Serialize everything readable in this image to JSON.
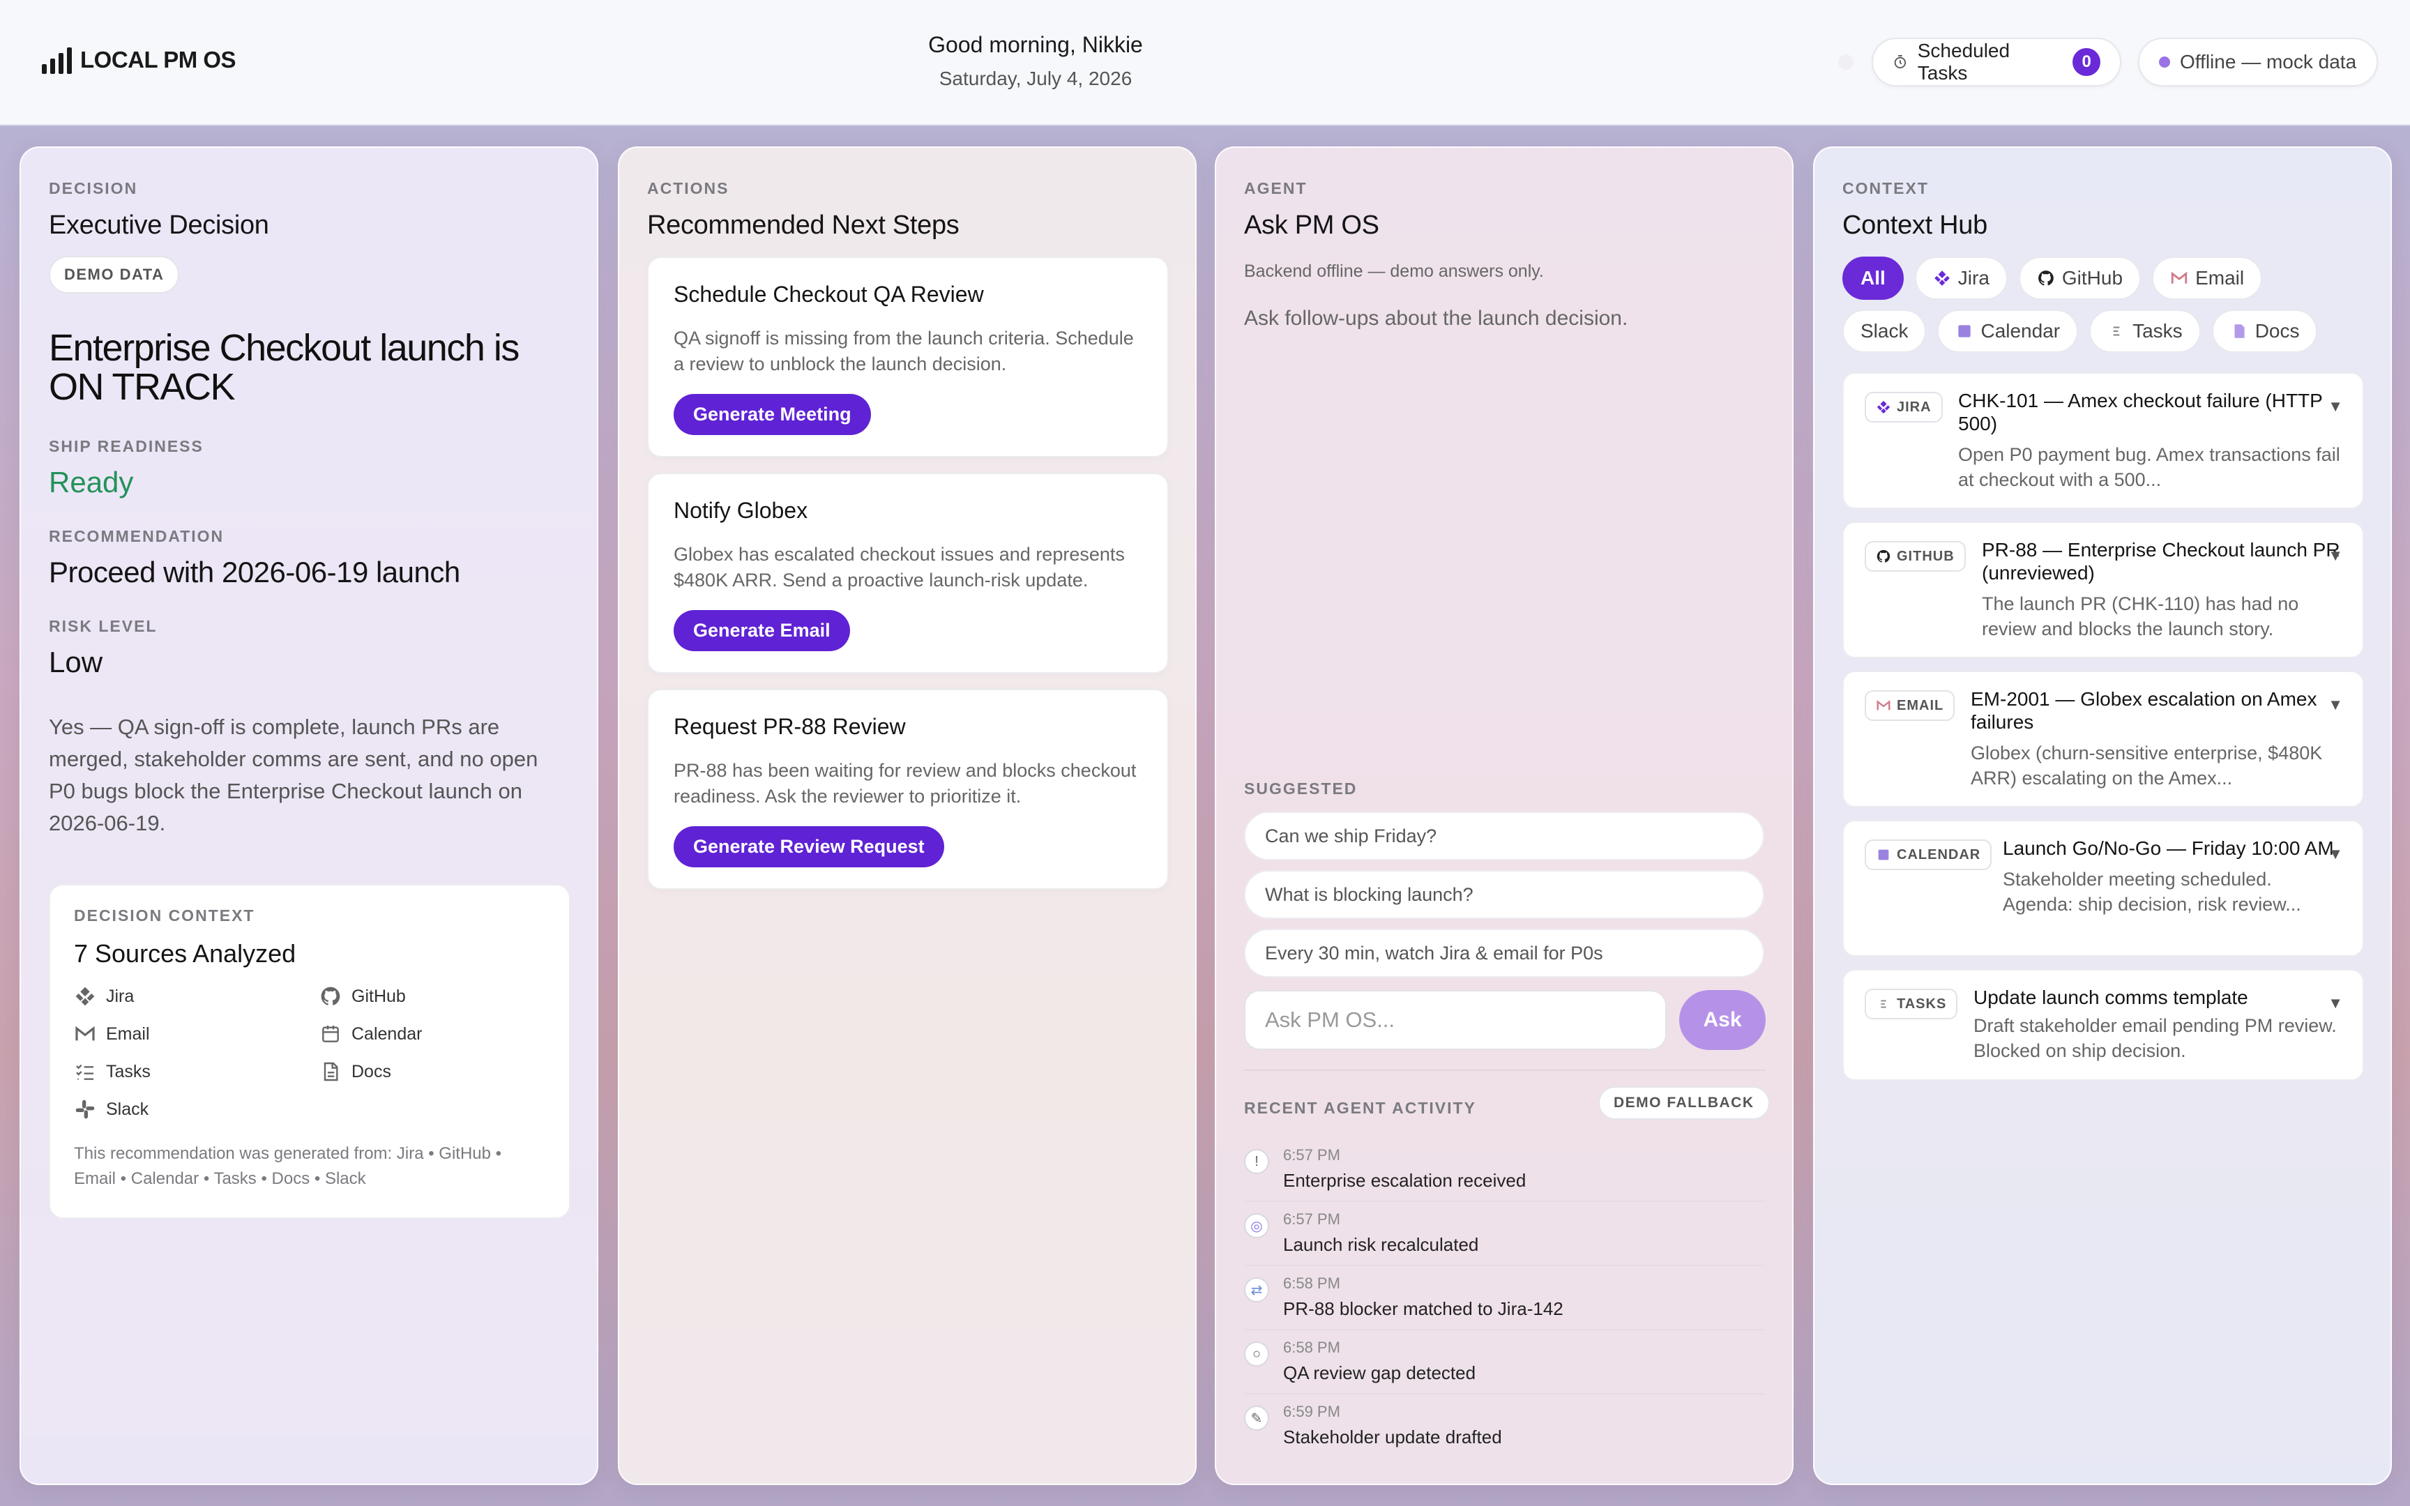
{
  "header": {
    "logo": "LOCAL PM OS",
    "greeting": "Good morning, Nikkie",
    "date": "Saturday, July 4, 2026",
    "scheduled_label": "Scheduled Tasks",
    "scheduled_count": "0",
    "status": "Offline — mock data"
  },
  "decision": {
    "kicker": "DECISION",
    "title": "Executive Decision",
    "chip": "DEMO DATA",
    "headline": "Enterprise Checkout launch is ON TRACK",
    "readiness_label": "SHIP READINESS",
    "readiness": "Ready",
    "recommendation_label": "RECOMMENDATION",
    "recommendation": "Proceed with 2026-06-19 launch",
    "risk_label": "RISK LEVEL",
    "risk": "Low",
    "summary": "Yes — QA sign-off is complete, launch PRs are merged, stakeholder comms are sent, and no open P0 bugs block the Enterprise Checkout launch on 2026-06-19.",
    "context": {
      "label": "DECISION CONTEXT",
      "title": "7 Sources Analyzed",
      "sources": [
        "Jira",
        "GitHub",
        "Email",
        "Calendar",
        "Tasks",
        "Docs",
        "Slack"
      ],
      "note": "This recommendation was generated from: Jira • GitHub • Email • Calendar • Tasks • Docs • Slack"
    }
  },
  "actions": {
    "kicker": "ACTIONS",
    "title": "Recommended Next Steps",
    "items": [
      {
        "title": "Schedule Checkout QA Review",
        "body": "QA signoff is missing from the launch criteria. Schedule a review to unblock the launch decision.",
        "button": "Generate Meeting"
      },
      {
        "title": "Notify Globex",
        "body": "Globex has escalated checkout issues and represents $480K ARR. Send a proactive launch-risk update.",
        "button": "Generate Email"
      },
      {
        "title": "Request PR-88 Review",
        "body": "PR-88 has been waiting for review and blocks checkout readiness. Ask the reviewer to prioritize it.",
        "button": "Generate Review Request"
      }
    ]
  },
  "agent": {
    "kicker": "AGENT",
    "title": "Ask PM OS",
    "backend_note": "Backend offline — demo answers only.",
    "hint": "Ask follow-ups about the launch decision.",
    "suggested_label": "SUGGESTED",
    "suggestions": [
      "Can we ship Friday?",
      "What is blocking launch?",
      "Every 30 min, watch Jira & email for P0s"
    ],
    "input_placeholder": "Ask PM OS...",
    "ask_button": "Ask",
    "activity_label": "RECENT AGENT ACTIVITY",
    "fallback_chip": "DEMO FALLBACK",
    "activity": [
      {
        "icon": "!",
        "time": "6:57 PM",
        "text": "Enterprise escalation received"
      },
      {
        "icon": "◎",
        "time": "6:57 PM",
        "text": "Launch risk recalculated"
      },
      {
        "icon": "⇄",
        "time": "6:58 PM",
        "text": "PR-88 blocker matched to Jira-142"
      },
      {
        "icon": "○",
        "time": "6:58 PM",
        "text": "QA review gap detected"
      },
      {
        "icon": "✎",
        "time": "6:59 PM",
        "text": "Stakeholder update drafted"
      }
    ]
  },
  "context_hub": {
    "kicker": "CONTEXT",
    "title": "Context Hub",
    "filters": [
      "All",
      "Jira",
      "GitHub",
      "Email",
      "Slack",
      "Calendar",
      "Tasks",
      "Docs"
    ],
    "items": [
      {
        "source": "JIRA",
        "title": "CHK-101 — Amex checkout failure (HTTP 500)",
        "body": "Open P0 payment bug. Amex transactions fail at checkout with a 500..."
      },
      {
        "source": "GITHUB",
        "title": "PR-88 — Enterprise Checkout launch PR (unreviewed)",
        "body": "The launch PR (CHK-110) has had no review and blocks the launch story."
      },
      {
        "source": "EMAIL",
        "title": "EM-2001 — Globex escalation on Amex failures",
        "body": "Globex (churn-sensitive enterprise, $480K ARR) escalating on the Amex..."
      },
      {
        "source": "CALENDAR",
        "title": "Launch Go/No-Go — Friday 10:00 AM",
        "body": "Stakeholder meeting scheduled. Agenda: ship decision, risk review..."
      },
      {
        "source": "TASKS",
        "title": "Update launch comms template",
        "body": "Draft stakeholder email pending PM review. Blocked on ship decision."
      }
    ]
  },
  "colors": {
    "accent": "#5f22d4",
    "ready": "#23925a"
  }
}
